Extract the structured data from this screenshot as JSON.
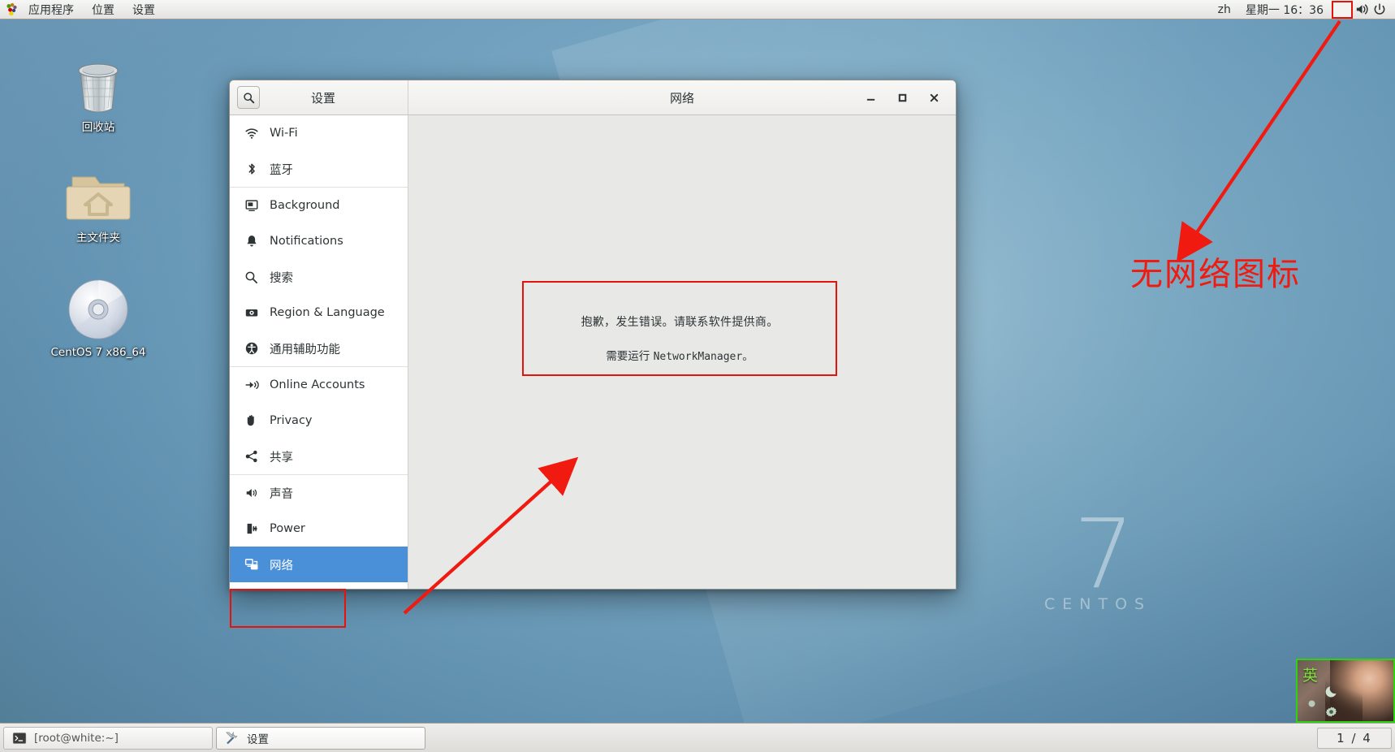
{
  "topbar": {
    "menus": [
      "应用程序",
      "位置",
      "设置"
    ],
    "language": "zh",
    "clock": "星期一 16：36",
    "icons": [
      "missing-network-icon",
      "volume-icon",
      "power-icon"
    ]
  },
  "desktop": {
    "icons": [
      {
        "label": "回收站",
        "icon": "trash-icon"
      },
      {
        "label": "主文件夹",
        "icon": "home-folder-icon"
      },
      {
        "label": "CentOS 7 x86_64",
        "icon": "optical-disc-icon"
      }
    ],
    "watermark_number": "7",
    "watermark_text": "CENTOS"
  },
  "window": {
    "left_title": "设置",
    "right_title": "网络",
    "search_icon": "search-icon",
    "controls": {
      "minimize": "–",
      "maximize": "□",
      "close": "✕"
    },
    "sidebar": [
      {
        "label": "Wi-Fi",
        "icon": "wifi-icon",
        "selected": false,
        "sep_after": false
      },
      {
        "label": "蓝牙",
        "icon": "bluetooth-icon",
        "selected": false,
        "sep_after": true
      },
      {
        "label": "Background",
        "icon": "background-icon",
        "selected": false,
        "sep_after": false
      },
      {
        "label": "Notifications",
        "icon": "bell-icon",
        "selected": false,
        "sep_after": false
      },
      {
        "label": "搜索",
        "icon": "search-icon",
        "selected": false,
        "sep_after": false
      },
      {
        "label": "Region & Language",
        "icon": "region-language-icon",
        "selected": false,
        "sep_after": false
      },
      {
        "label": "通用辅助功能",
        "icon": "accessibility-icon",
        "selected": false,
        "sep_after": true
      },
      {
        "label": "Online Accounts",
        "icon": "online-accounts-icon",
        "selected": false,
        "sep_after": false
      },
      {
        "label": "Privacy",
        "icon": "privacy-hand-icon",
        "selected": false,
        "sep_after": false
      },
      {
        "label": "共享",
        "icon": "share-icon",
        "selected": false,
        "sep_after": true
      },
      {
        "label": "声音",
        "icon": "sound-icon",
        "selected": false,
        "sep_after": false
      },
      {
        "label": "Power",
        "icon": "power-plug-icon",
        "selected": false,
        "sep_after": false
      },
      {
        "label": "网络",
        "icon": "network-icon",
        "selected": true,
        "sep_after": false
      }
    ],
    "error": {
      "line1": "抱歉，发生错误。请联系软件提供商。",
      "line2_prefix": "需要运行 ",
      "line2_mono": "NetworkManager",
      "line2_suffix": "。"
    }
  },
  "annotations": {
    "label_no_network_icon": "无网络图标",
    "color": "#f01a10"
  },
  "taskbar": {
    "buttons": [
      {
        "label": "[root@white:~]",
        "icon": "terminal-icon",
        "active": false
      },
      {
        "label": "设置",
        "icon": "settings-tools-icon",
        "active": true
      }
    ],
    "workspace_indicator": "1 / 4"
  },
  "ime": {
    "mode": "英",
    "icons": [
      "moon-icon",
      "dot-icon",
      "gear-icon"
    ]
  }
}
